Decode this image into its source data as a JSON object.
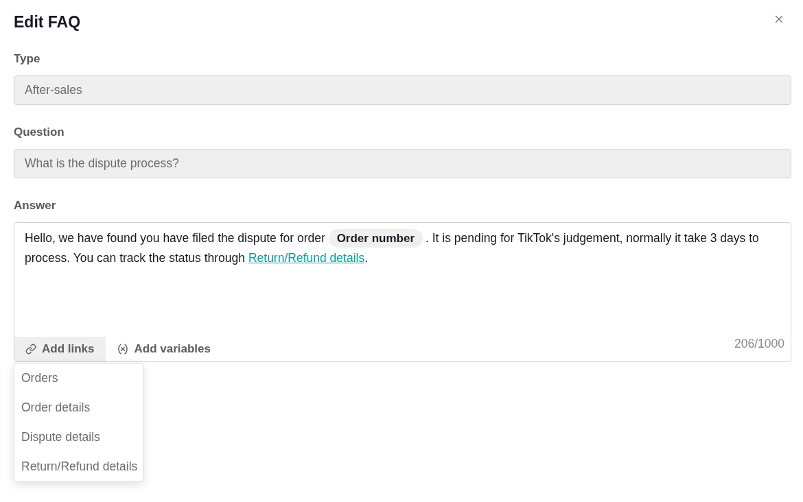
{
  "dialog": {
    "title": "Edit FAQ"
  },
  "fields": [
    {
      "label": "Type",
      "value": "After-sales",
      "disabled": true
    },
    {
      "label": "Question",
      "value": "What is the dispute process?",
      "disabled": true
    }
  ],
  "answer": {
    "label": "Answer",
    "segments": [
      {
        "kind": "text",
        "text": "Hello, we have found you have filed the dispute for order "
      },
      {
        "kind": "variable",
        "text": "Order number"
      },
      {
        "kind": "text",
        "text": ". It is pending for TikTok's judgement, normally it take 3 days to process. You can track the status through "
      },
      {
        "kind": "link",
        "text": "Return/Refund details"
      },
      {
        "kind": "text",
        "text": "."
      }
    ],
    "counter": "206/1000"
  },
  "toolbar": [
    {
      "kind": "links",
      "label": "Add links",
      "expanded": true,
      "menu": [
        "Orders",
        "Order details",
        "Dispute details",
        "Return/Refund details"
      ]
    },
    {
      "kind": "variables",
      "label": "Add variables",
      "expanded": false
    }
  ]
}
